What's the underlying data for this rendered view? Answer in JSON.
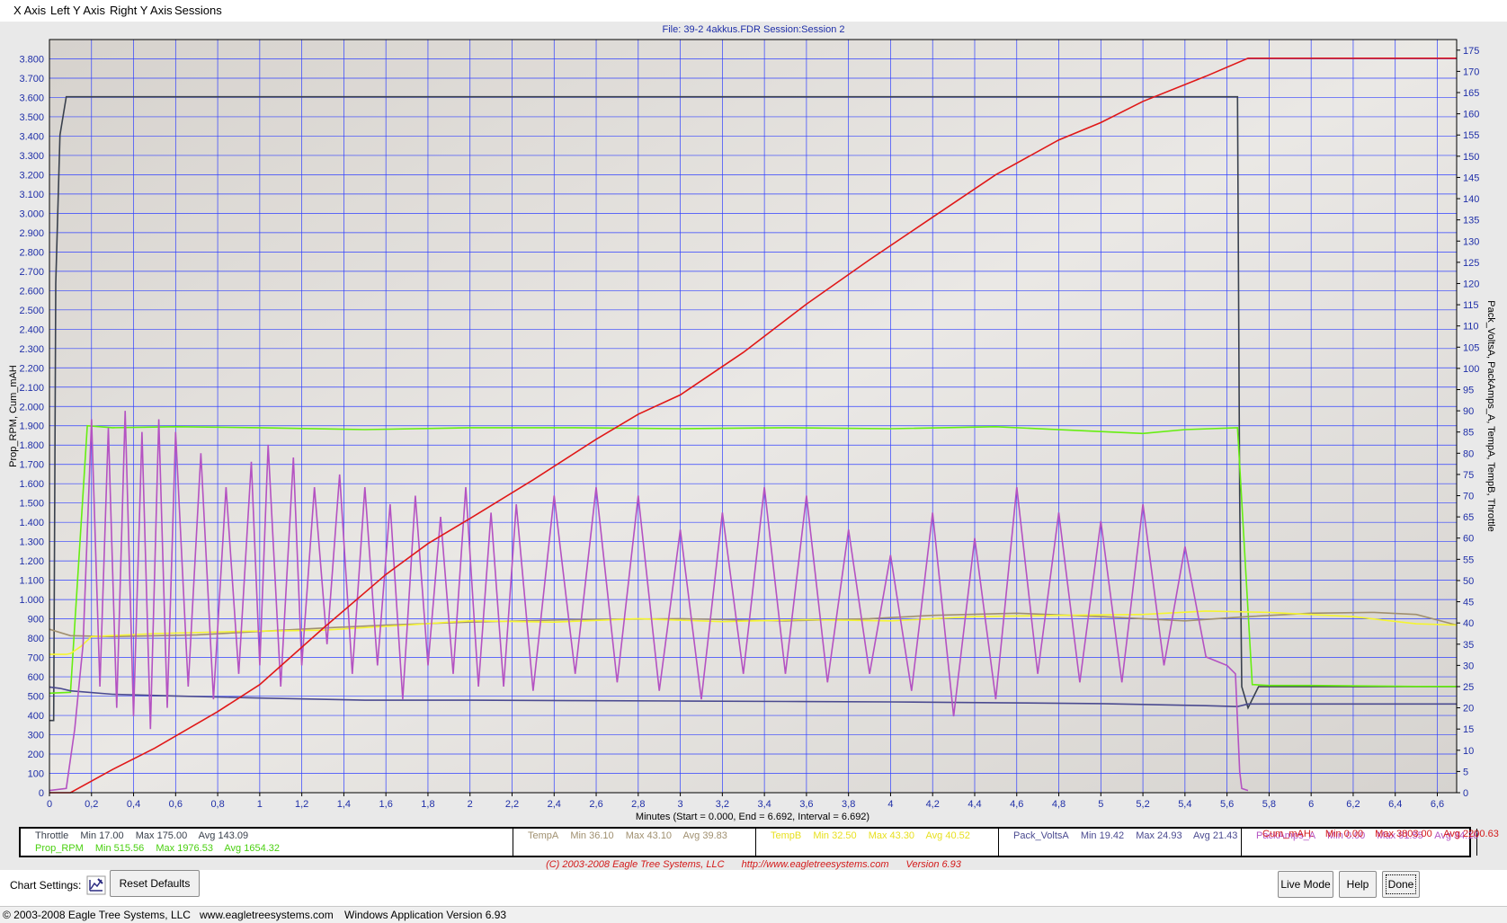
{
  "menu": {
    "items": [
      {
        "label": "X Axis",
        "accel": "X"
      },
      {
        "label": "Left Y Axis",
        "accel": "L"
      },
      {
        "label": "Right Y Axis",
        "accel": "R"
      },
      {
        "label": "Sessions",
        "accel": ""
      }
    ]
  },
  "chart_data": {
    "type": "line",
    "title": "File: 39-2 4akkus.FDR   Session:Session 2",
    "xlabel": "Minutes (Start = 0.000,  End = 6.692,  Interval =  6.692)",
    "ylabel_left": "Prop_RPM, Cum_mAH",
    "ylabel_right": "Pack_VoltsA, PackAmps_A, TempA, TempB, Throttle",
    "xlim": [
      0,
      6.692
    ],
    "ylim_left": [
      0,
      3900
    ],
    "ylim_right": [
      0,
      177.5
    ],
    "x_ticks": [
      "0",
      "0,2",
      "0,4",
      "0,6",
      "0,8",
      "1",
      "1,2",
      "1,4",
      "1,6",
      "1,8",
      "2",
      "2,2",
      "2,4",
      "2,6",
      "2,8",
      "3",
      "3,2",
      "3,4",
      "3,6",
      "3,8",
      "4",
      "4,2",
      "4,4",
      "4,6",
      "4,8",
      "5",
      "5,2",
      "5,4",
      "5,6",
      "5,8",
      "6",
      "6,2",
      "6,4",
      "6,6"
    ],
    "x_tick_values": [
      0,
      0.2,
      0.4,
      0.6,
      0.8,
      1,
      1.2,
      1.4,
      1.6,
      1.8,
      2,
      2.2,
      2.4,
      2.6,
      2.8,
      3,
      3.2,
      3.4,
      3.6,
      3.8,
      4,
      4.2,
      4.4,
      4.6,
      4.8,
      5,
      5.2,
      5.4,
      5.6,
      5.8,
      6,
      6.2,
      6.4,
      6.6
    ],
    "y_left_ticks": [
      "0",
      "100",
      "200",
      "300",
      "400",
      "500",
      "600",
      "700",
      "800",
      "900",
      "1.000",
      "1.100",
      "1.200",
      "1.300",
      "1.400",
      "1.500",
      "1.600",
      "1.700",
      "1.800",
      "1.900",
      "2.000",
      "2.100",
      "2.200",
      "2.300",
      "2.400",
      "2.500",
      "2.600",
      "2.700",
      "2.800",
      "2.900",
      "3.000",
      "3.100",
      "3.200",
      "3.300",
      "3.400",
      "3.500",
      "3.600",
      "3.700",
      "3.800"
    ],
    "y_left_tick_values": [
      0,
      100,
      200,
      300,
      400,
      500,
      600,
      700,
      800,
      900,
      1000,
      1100,
      1200,
      1300,
      1400,
      1500,
      1600,
      1700,
      1800,
      1900,
      2000,
      2100,
      2200,
      2300,
      2400,
      2500,
      2600,
      2700,
      2800,
      2900,
      3000,
      3100,
      3200,
      3300,
      3400,
      3500,
      3600,
      3700,
      3800
    ],
    "y_right_ticks": [
      "0",
      "5",
      "10",
      "15",
      "20",
      "25",
      "30",
      "35",
      "40",
      "45",
      "50",
      "55",
      "60",
      "65",
      "70",
      "75",
      "80",
      "85",
      "90",
      "95",
      "100",
      "105",
      "110",
      "115",
      "120",
      "125",
      "130",
      "135",
      "140",
      "145",
      "150",
      "155",
      "160",
      "165",
      "170",
      "175"
    ],
    "y_right_tick_values": [
      0,
      5,
      10,
      15,
      20,
      25,
      30,
      35,
      40,
      45,
      50,
      55,
      60,
      65,
      70,
      75,
      80,
      85,
      90,
      95,
      100,
      105,
      110,
      115,
      120,
      125,
      130,
      135,
      140,
      145,
      150,
      155,
      160,
      165,
      170,
      175
    ],
    "grid": true,
    "series": [
      {
        "name": "Throttle",
        "axis": "right",
        "color": "#3a414d",
        "x": [
          0,
          0.02,
          0.03,
          0.05,
          0.08,
          0.2,
          0.5,
          1.0,
          2.0,
          3.0,
          4.0,
          5.0,
          5.5,
          5.65,
          5.66,
          5.67,
          5.7,
          5.75,
          6.0,
          6.5,
          6.692
        ],
        "y": [
          17,
          17,
          120,
          155,
          164,
          164,
          164,
          164,
          164,
          164,
          164,
          164,
          164,
          164,
          70,
          25,
          20,
          25,
          25,
          25,
          25
        ]
      },
      {
        "name": "Prop_RPM",
        "axis": "left",
        "color": "#66ee11",
        "x": [
          0,
          0.1,
          0.18,
          0.3,
          0.6,
          1.0,
          1.5,
          2.0,
          2.5,
          3.0,
          3.5,
          4.0,
          4.5,
          5.0,
          5.2,
          5.4,
          5.65,
          5.72,
          5.8,
          6.0,
          6.5,
          6.692
        ],
        "y": [
          515,
          520,
          1900,
          1890,
          1895,
          1890,
          1880,
          1890,
          1890,
          1885,
          1890,
          1885,
          1895,
          1870,
          1860,
          1880,
          1890,
          560,
          555,
          555,
          550,
          550
        ]
      },
      {
        "name": "TempA",
        "axis": "right",
        "color": "#a09070",
        "x": [
          0,
          0.1,
          0.3,
          0.7,
          1.0,
          1.3,
          1.6,
          2.0,
          2.5,
          3.0,
          3.5,
          3.9,
          4.2,
          4.6,
          5.0,
          5.4,
          5.7,
          6.0,
          6.3,
          6.5,
          6.692
        ],
        "y": [
          38.5,
          37.0,
          36.8,
          37.2,
          38.0,
          38.8,
          39.5,
          40.2,
          40.8,
          41.0,
          40.5,
          41.0,
          41.8,
          42.3,
          41.5,
          40.5,
          41.5,
          42.3,
          42.5,
          42.0,
          39.5
        ]
      },
      {
        "name": "TempB",
        "axis": "right",
        "color": "#f5f530",
        "x": [
          0,
          0.08,
          0.1,
          0.15,
          0.2,
          0.5,
          0.9,
          1.3,
          1.7,
          2.0,
          2.4,
          2.8,
          3.2,
          3.6,
          4.0,
          4.4,
          4.8,
          5.2,
          5.5,
          5.8,
          6.2,
          6.5,
          6.692
        ],
        "y": [
          32.6,
          32.6,
          32.8,
          34.5,
          36.8,
          37.5,
          38.0,
          38.3,
          39.5,
          40.5,
          40.2,
          41.0,
          40.3,
          40.8,
          40.5,
          41.5,
          41.8,
          42.0,
          42.8,
          42.5,
          41.5,
          39.8,
          39.5
        ]
      },
      {
        "name": "Pack_VoltsA",
        "axis": "right",
        "color": "#4a4a90",
        "x": [
          0,
          0.05,
          0.1,
          0.3,
          0.6,
          1.0,
          1.5,
          2.0,
          2.5,
          3.0,
          3.5,
          4.0,
          4.5,
          5.0,
          5.5,
          5.65,
          5.7,
          6.0,
          6.5,
          6.692
        ],
        "y": [
          24.9,
          24.6,
          24.0,
          23.2,
          22.8,
          22.3,
          21.8,
          21.8,
          21.7,
          21.6,
          21.5,
          21.4,
          21.2,
          21.0,
          20.5,
          20.3,
          20.9,
          20.9,
          20.9,
          20.9
        ]
      },
      {
        "name": "PackAmps_A",
        "axis": "right",
        "color": "#b452c2",
        "x": [
          0,
          0.08,
          0.12,
          0.16,
          0.2,
          0.24,
          0.28,
          0.32,
          0.36,
          0.4,
          0.44,
          0.48,
          0.52,
          0.56,
          0.6,
          0.66,
          0.72,
          0.78,
          0.84,
          0.9,
          0.96,
          1.0,
          1.04,
          1.1,
          1.16,
          1.2,
          1.26,
          1.32,
          1.38,
          1.44,
          1.5,
          1.56,
          1.62,
          1.68,
          1.74,
          1.8,
          1.86,
          1.92,
          1.98,
          2.04,
          2.1,
          2.16,
          2.22,
          2.3,
          2.4,
          2.5,
          2.6,
          2.7,
          2.8,
          2.9,
          3.0,
          3.1,
          3.2,
          3.3,
          3.4,
          3.5,
          3.6,
          3.7,
          3.8,
          3.9,
          4.0,
          4.1,
          4.2,
          4.3,
          4.4,
          4.5,
          4.6,
          4.7,
          4.8,
          4.9,
          5.0,
          5.1,
          5.2,
          5.3,
          5.4,
          5.5,
          5.6,
          5.64,
          5.66,
          5.67,
          5.7
        ],
        "y": [
          0.5,
          1,
          15,
          35,
          88,
          25,
          86,
          20,
          90,
          18,
          85,
          15,
          88,
          20,
          85,
          25,
          80,
          22,
          72,
          28,
          78,
          30,
          82,
          25,
          79,
          30,
          72,
          35,
          75,
          28,
          72,
          30,
          68,
          22,
          70,
          30,
          65,
          28,
          72,
          25,
          66,
          25,
          68,
          24,
          70,
          28,
          72,
          26,
          70,
          24,
          62,
          22,
          66,
          28,
          72,
          28,
          70,
          26,
          62,
          28,
          56,
          24,
          66,
          18,
          60,
          22,
          72,
          28,
          66,
          26,
          64,
          26,
          68,
          30,
          58,
          32,
          30,
          28,
          5,
          1,
          0.5
        ]
      },
      {
        "name": "Cum_mAH",
        "axis": "left",
        "color": "#e01818",
        "x": [
          0,
          0.1,
          0.3,
          0.5,
          0.8,
          1.0,
          1.3,
          1.6,
          1.8,
          2.0,
          2.3,
          2.6,
          2.8,
          3.0,
          3.3,
          3.6,
          3.9,
          4.2,
          4.5,
          4.8,
          5.0,
          5.2,
          5.5,
          5.7,
          6.0,
          6.5,
          6.692
        ],
        "y": [
          0,
          0,
          120,
          230,
          420,
          560,
          850,
          1130,
          1290,
          1420,
          1620,
          1830,
          1960,
          2060,
          2280,
          2530,
          2760,
          2980,
          3200,
          3380,
          3470,
          3580,
          3710,
          3803,
          3803,
          3803,
          3803
        ]
      }
    ]
  },
  "legend": {
    "cells": [
      {
        "name": "Throttle",
        "min": "Min 17.00",
        "max": "Max 175.00",
        "avg": "Avg 143.09",
        "color": "#3a414d",
        "name2": "Prop_RPM",
        "min2": "Min 515.56",
        "max2": "Max 1976.53",
        "avg2": "Avg 1654.32",
        "color2": "#4ad010"
      },
      {
        "name": "TempA",
        "min": "Min 36.10",
        "max": "Max 43.10",
        "avg": "Avg 39.83",
        "color": "#a09070"
      },
      {
        "name": "TempB",
        "min": "Min 32.50",
        "max": "Max 43.30",
        "avg": "Avg 40.52",
        "color": "#e8e020"
      },
      {
        "name": "Pack_VoltsA",
        "min": "Min 19.42",
        "max": "Max 24.93",
        "avg": "Avg 21.43",
        "color": "#4a4a90"
      },
      {
        "name": "PackAmps_A",
        "min": "Min 0.00",
        "max": "Max 91.55",
        "avg": "Avg 34.10",
        "color": "#b452c2"
      },
      {
        "name": "Cum_mAH:",
        "min": "Min 0.00",
        "max": "Max 3803.00",
        "avg": "Avg 2200.63",
        "color": "#d31a1a"
      }
    ]
  },
  "footer_credit": {
    "copyright": "(C) 2003-2008 Eagle Tree Systems, LLC",
    "url": "http://www.eagletreesystems.com",
    "version": "Version 6.93"
  },
  "controls": {
    "chart_settings_label": "Chart Settings:",
    "reset_defaults": "Reset Defaults",
    "live_mode": "Live Mode",
    "help": "Help",
    "done": "Done"
  },
  "statusbar": {
    "copyright": "© 2003-2008 Eagle Tree Systems, LLC",
    "url": "www.eagletreesystems.com",
    "version": "Windows Application Version 6.93"
  }
}
